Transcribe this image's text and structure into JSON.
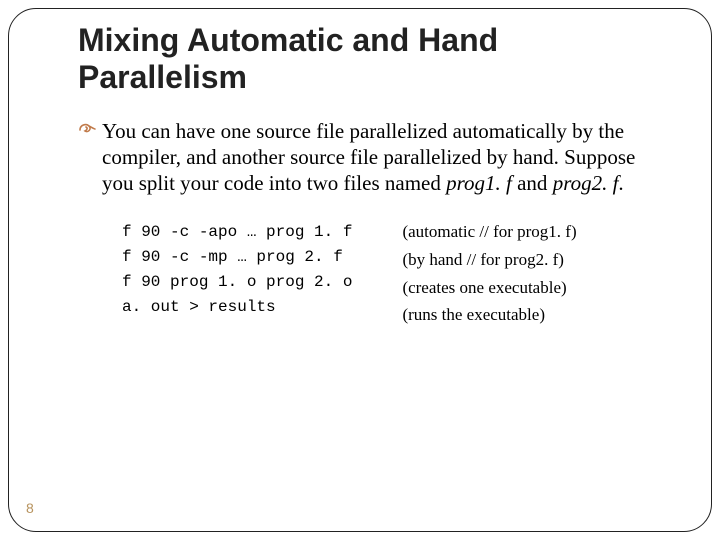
{
  "title": "Mixing Automatic and Hand Parallelism",
  "paragraph": {
    "lead": "You can have one source file parallelized automatically by the compiler, and another source file parallelized by hand. Suppose you split your code into two files named ",
    "file1": "prog1. f",
    "mid": " and ",
    "file2": "prog2. f",
    "tail": "."
  },
  "code": {
    "l1": "f 90 -c -apo … prog 1. f",
    "l2": "f 90 -c -mp … prog 2. f",
    "l3": "f 90 prog 1. o prog 2. o",
    "l4": "a. out > results"
  },
  "notes": {
    "l1": "(automatic // for prog1. f)",
    "l2": "(by hand // for prog2. f)",
    "l3": "(creates one executable)",
    "l4": "(runs the executable)"
  },
  "page_number": "8"
}
